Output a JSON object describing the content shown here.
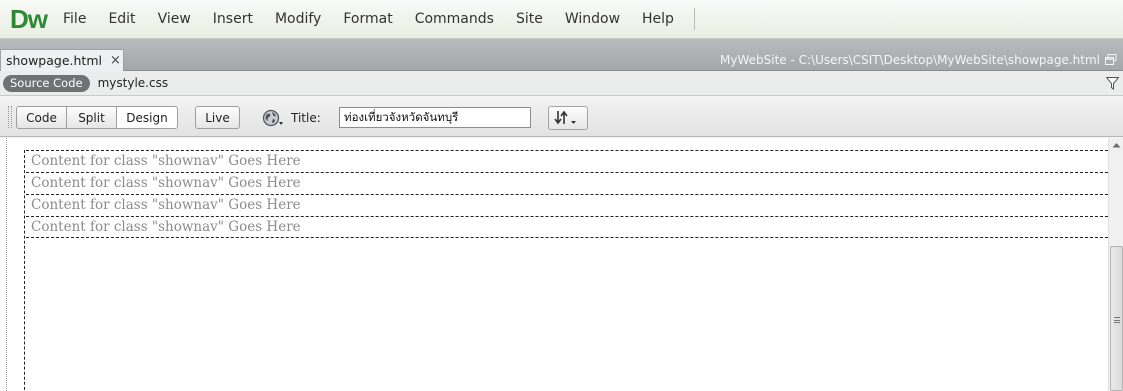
{
  "app": {
    "logo": "Dw",
    "menu": [
      "File",
      "Edit",
      "View",
      "Insert",
      "Modify",
      "Format",
      "Commands",
      "Site",
      "Window",
      "Help"
    ]
  },
  "document": {
    "tab_label": "showpage.html",
    "close_glyph": "×",
    "path": "MyWebSite - C:\\Users\\CSIT\\Desktop\\MyWebSite\\showpage.html"
  },
  "related_files": {
    "source_code_label": "Source Code",
    "css_file": "mystyle.css"
  },
  "toolbar": {
    "views": [
      "Code",
      "Split",
      "Design"
    ],
    "active_view": "Design",
    "live_label": "Live",
    "title_label": "Title:",
    "title_value": "ท่องเที่ยวจังหวัดจันทบุรี"
  },
  "design_view": {
    "nav_placeholders": [
      "Content for class \"shownav\" Goes Here",
      "Content for class \"shownav\" Goes Here",
      "Content for class \"shownav\" Goes Here",
      "Content for class \"shownav\" Goes Here"
    ]
  },
  "icons": {
    "globe": "globe-icon",
    "sort": "sort-arrows-icon",
    "filter": "filter-icon",
    "restore": "restore-window-icon",
    "scroll_up": "scroll-up-arrow-icon"
  },
  "colors": {
    "dw_green": "#2c8a35",
    "placeholder_text": "#8c8c8c",
    "source_pill": "#6e7275"
  }
}
